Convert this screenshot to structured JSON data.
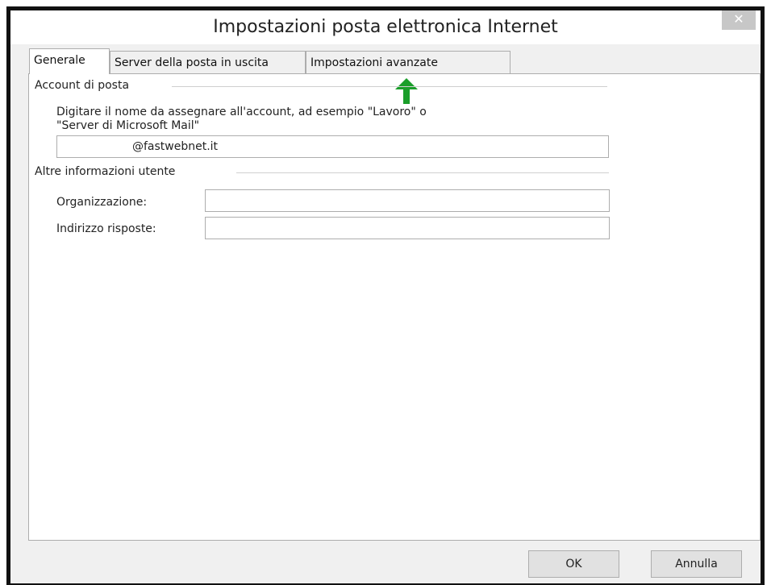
{
  "window": {
    "title": "Impostazioni posta elettronica Internet",
    "close_glyph": "✕"
  },
  "tabs": [
    {
      "label": "Generale",
      "active": true
    },
    {
      "label": "Server della posta in uscita",
      "active": false
    },
    {
      "label": "Impostazioni avanzate",
      "active": false
    }
  ],
  "account_group": {
    "label": "Account di posta",
    "instruction_line1": "Digitare il nome da assegnare all'account, ad esempio \"Lavoro\" o",
    "instruction_line2": "\"Server di Microsoft Mail\"",
    "account_name_value": "@fastwebnet.it"
  },
  "user_info_group": {
    "label": "Altre informazioni utente",
    "organization_label": "Organizzazione:",
    "organization_value": "",
    "reply_label": "Indirizzo risposte:",
    "reply_value": ""
  },
  "annotation": {
    "arrow_color": "#1a9e2a",
    "icon": "up-arrow-icon"
  },
  "buttons": {
    "ok": "OK",
    "cancel": "Annulla"
  }
}
